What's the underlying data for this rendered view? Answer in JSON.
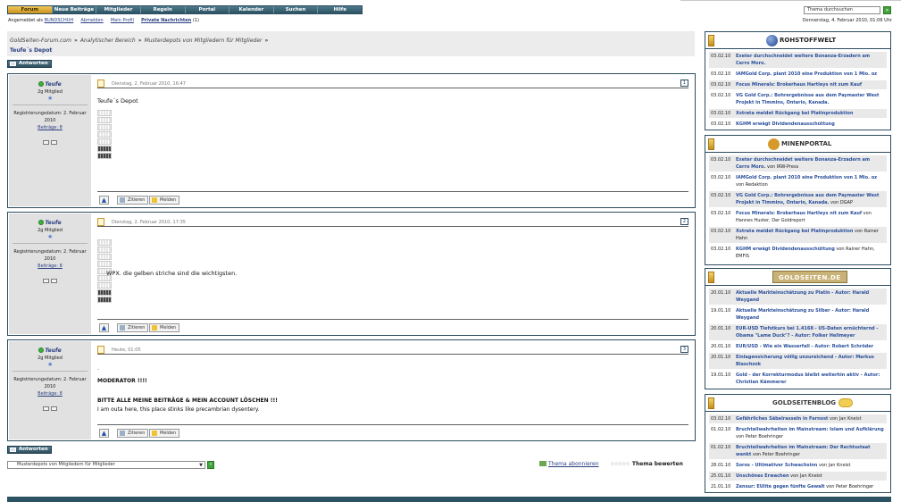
{
  "nav": {
    "items": [
      "Forum",
      "Neue Beiträge",
      "Mitglieder",
      "Regeln",
      "Portal",
      "Kalender",
      "Suchen",
      "Hilfe"
    ]
  },
  "search": {
    "value": "Thema durchsuchen",
    "go": "»"
  },
  "userbar": {
    "logged_in_prefix": "Angemeldet als",
    "username": "BUNDSCHUH",
    "logout": "Abmelden",
    "profile": "Mein Profil",
    "pm": "Private Nachrichten",
    "pm_count": "(1)",
    "datetime": "Donnerstag, 4. Februar 2010, 01:06 Uhr"
  },
  "breadcrumb": {
    "items": [
      "GoldSeiten-Forum.com",
      "Analytischer Bereich",
      "Musterdepots von Mitgliedern für Mitglieder"
    ],
    "sep": "»",
    "thread_title": "Teufe´s Depot"
  },
  "reply_label": "Antworten",
  "posts": [
    {
      "author": "Teufe",
      "rank": "2g Mitglied",
      "star": "★",
      "reg_label": "Registrierungsdatum: 2. Februar 2010",
      "posts_label": "Beiträge: 8",
      "date": "Dienstag, 2. Februar 2010, 16:47",
      "number": "1",
      "text": "Teufe´s Depot",
      "quote_label": "Zitieren",
      "report_label": "Melden",
      "top": "▲"
    },
    {
      "author": "Teufe",
      "rank": "2g Mitglied",
      "star": "★",
      "reg_label": "Registrierungsdatum: 2. Februar 2010",
      "posts_label": "Beiträge: 8",
      "date": "Dienstag, 2. Februar 2010, 17:35",
      "number": "2",
      "text": "WPX. die gelben striche sind die wichtigsten.",
      "quote_label": "Zitieren",
      "report_label": "Melden",
      "top": "▲"
    },
    {
      "author": "Teufe",
      "rank": "2g Mitglied",
      "star": "★",
      "reg_label": "Registrierungsdatum: 2. Februar 2010",
      "posts_label": "Beiträge: 8",
      "date": "Heute, 01:05",
      "number": "3",
      "text_dot": ".",
      "text_line1": "MODERATOR !!!!",
      "text_line2": "BITTE ALLE MEINE BEITRÄGE & MEIN ACCOUNT LÖSCHEN !!!",
      "text_line3": "I am outa here, this place stinks like precambrian dysentery.",
      "quote_label": "Zitieren",
      "report_label": "Melden",
      "top": "▲"
    }
  ],
  "lower": {
    "jump_value": "Musterdepots von Mitgliedern für Mitglieder",
    "subscribe": "Thema abonnieren",
    "rate": "Thema bewerten",
    "stars": "☆☆☆☆☆"
  },
  "widgets": {
    "rohstoffwelt": {
      "logo": "ROHSTOFFWELT",
      "rows": [
        {
          "date": "03.02.10",
          "title": "Exeter durchschneidet weitere Bonanza-Erzadern am Cerro Moro."
        },
        {
          "date": "03.02.10",
          "title": "IAMGold Corp. plant 2010 eine Produktion von 1 Mio. oz"
        },
        {
          "date": "03.02.10",
          "title": "Focus Minerals: Brokerhaus Hartleys nit zum Kauf"
        },
        {
          "date": "03.02.10",
          "title": "VG Gold Corp.: Bohrergebnisse aus dem Paymaster West Projekt in Timmins, Ontario, Kanada."
        },
        {
          "date": "03.02.10",
          "title": "Xstrata meldet Rückgang bei Platinproduktion"
        },
        {
          "date": "03.02.10",
          "title": "KGHM erwägt Dividendenausschüttung"
        }
      ]
    },
    "minenportal": {
      "logo": "MINENPORTAL",
      "rows": [
        {
          "date": "03.02.10",
          "title": "Exeter durchschneidet weitere Bonanza-Erzadern am Cerro Moro.",
          "by": "von IRW-Press"
        },
        {
          "date": "03.02.10",
          "title": "IAMGold Corp. plant 2010 eine Produktion von 1 Mio. oz",
          "by": "von Redaktion"
        },
        {
          "date": "03.02.10",
          "title": "VG Gold Corp.: Bohrergebnisse aus dem Paymaster West Projekt in Timmins, Ontario, Kanada.",
          "by": "von DGAP"
        },
        {
          "date": "03.02.10",
          "title": "Focus Minerals: Brokerhaus Hartleys nit zum Kauf",
          "by": "von Hannes Huster, Der Goldreport"
        },
        {
          "date": "03.02.10",
          "title": "Xstrata meldet Rückgang bei Platinproduktion",
          "by": "von Rainer Hahn"
        },
        {
          "date": "03.02.10",
          "title": "KGHM erwägt Dividendenausschüttung",
          "by": "von Rainer Hahn, EMFIS"
        }
      ]
    },
    "goldseiten": {
      "logo": "GOLDSEITEN.DE",
      "rows": [
        {
          "date": "20.01.10",
          "title": "Aktuelle Markteinschätzung zu Platin - Autor: Harald Weygand"
        },
        {
          "date": "19.01.10",
          "title": "Aktuelle Markteinschätzung zu Silber - Autor: Harald Weygand"
        },
        {
          "date": "20.01.10",
          "title": "EUR-USD Tiefstkurs bei 1.4168 - US-Daten ernüchternd - Obama \"Lame Duck\"? - Autor: Folker Hellmeyer"
        },
        {
          "date": "20.01.10",
          "title": "EUR/USD - Wie ein Wasserfall - Autor: Robert Schröder"
        },
        {
          "date": "20.01.10",
          "title": "Einlagensicherung völlig unzureichend - Autor: Markus Blaschzok"
        },
        {
          "date": "19.01.10",
          "title": "Gold - der Korrekturmodus bleibt weiterhin aktiv - Autor: Christian Kämmerer"
        }
      ]
    },
    "goldseitenblog": {
      "logo": "GOLDSEITENBLOG",
      "rows": [
        {
          "date": "03.02.10",
          "title": "Gefährliches Säbelrasseln in Fernost",
          "by": "von Jan Kneist"
        },
        {
          "date": "01.02.10",
          "title": "Bruchteilwahrheiten im Mainstream: Islam und Aufklärung",
          "by": "von Peter Boehringer"
        },
        {
          "date": "01.02.10",
          "title": "Bruchteilwahrheiten im Mainstream: Der Rechtsstaat wankt",
          "by": "von Peter Boehringer"
        },
        {
          "date": "28.01.10",
          "title": "Soros - Ultimativer Schwachsinn",
          "by": "von Jan Kneist"
        },
        {
          "date": "25.01.10",
          "title": "Unschönes Erwachen",
          "by": "von Jan Kneist"
        },
        {
          "date": "21.01.10",
          "title": "Zensur: EUlite gegen fünfte Gewalt",
          "by": "von Peter Boehringer"
        }
      ]
    }
  }
}
